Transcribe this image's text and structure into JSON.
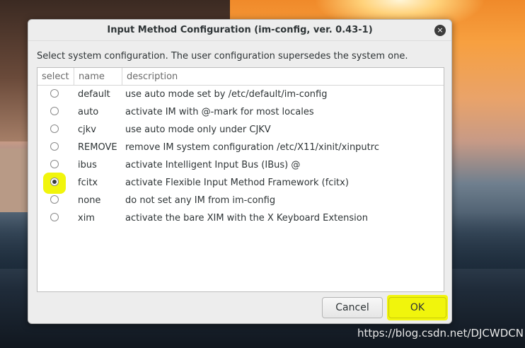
{
  "dialog": {
    "title": "Input Method Configuration (im-config, ver. 0.43-1)",
    "close_glyph": "×",
    "prompt": "Select system configuration. The user configuration supersedes the system one.",
    "columns": {
      "select": "select",
      "name": "name",
      "description": "description"
    },
    "rows": [
      {
        "name": "default",
        "description": "use auto mode set by /etc/default/im-config",
        "selected": false
      },
      {
        "name": "auto",
        "description": "activate IM with @-mark for most locales",
        "selected": false
      },
      {
        "name": "cjkv",
        "description": "use auto mode only under CJKV",
        "selected": false
      },
      {
        "name": "REMOVE",
        "description": "remove IM system configuration /etc/X11/xinit/xinputrc",
        "selected": false
      },
      {
        "name": "ibus",
        "description": "activate Intelligent Input Bus (IBus) @",
        "selected": false
      },
      {
        "name": "fcitx",
        "description": "activate Flexible Input Method Framework (fcitx)",
        "selected": true
      },
      {
        "name": "none",
        "description": "do not set any IM from im-config",
        "selected": false
      },
      {
        "name": "xim",
        "description": "activate the bare XIM with the X Keyboard Extension",
        "selected": false
      }
    ],
    "buttons": {
      "cancel": "Cancel",
      "ok": "OK"
    },
    "highlight_color": "#f1f50c"
  },
  "watermark": "https://blog.csdn.net/DJCWDCN"
}
